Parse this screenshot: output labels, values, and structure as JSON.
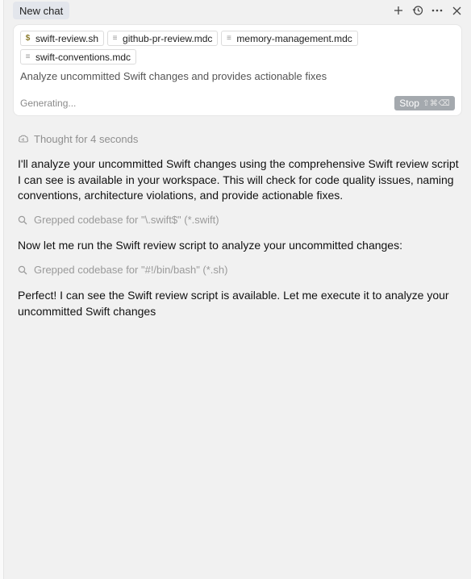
{
  "header": {
    "tab_label": "New chat",
    "actions": [
      "plus-icon",
      "history-icon",
      "more-icon",
      "close-icon"
    ]
  },
  "composer": {
    "chips": [
      {
        "icon": "dollar-file-icon",
        "label": "swift-review.sh"
      },
      {
        "icon": "doc-icon",
        "label": "github-pr-review.mdc"
      },
      {
        "icon": "doc-icon",
        "label": "memory-management.mdc"
      },
      {
        "icon": "doc-icon",
        "label": "swift-conventions.mdc"
      }
    ],
    "prompt_text": "Analyze uncommitted Swift changes and provides actionable fixes",
    "status_text": "Generating...",
    "stop_label": "Stop",
    "stop_shortcut": "⇧⌘⌫"
  },
  "conversation": {
    "thought": "Thought for 4 seconds",
    "para1": "I'll analyze your uncommitted Swift changes using the comprehensive Swift review script I can see is available in your workspace. This will check for code quality issues, naming conventions, architecture violations, and provide actionable fixes.",
    "tool1": "Grepped codebase for \"\\.swift$\" (*.swift)",
    "para2": "Now let me run the Swift review script to analyze your uncommitted changes:",
    "tool2": "Grepped codebase for \"#!/bin/bash\" (*.sh)",
    "para3": "Perfect! I can see the Swift review script is available. Let me execute it to analyze your uncommitted Swift changes"
  },
  "colors": {
    "background": "#f1f1f1",
    "card": "#ffffff",
    "tab": "#e3e6ec",
    "stop_button": "#a4a9ae"
  }
}
